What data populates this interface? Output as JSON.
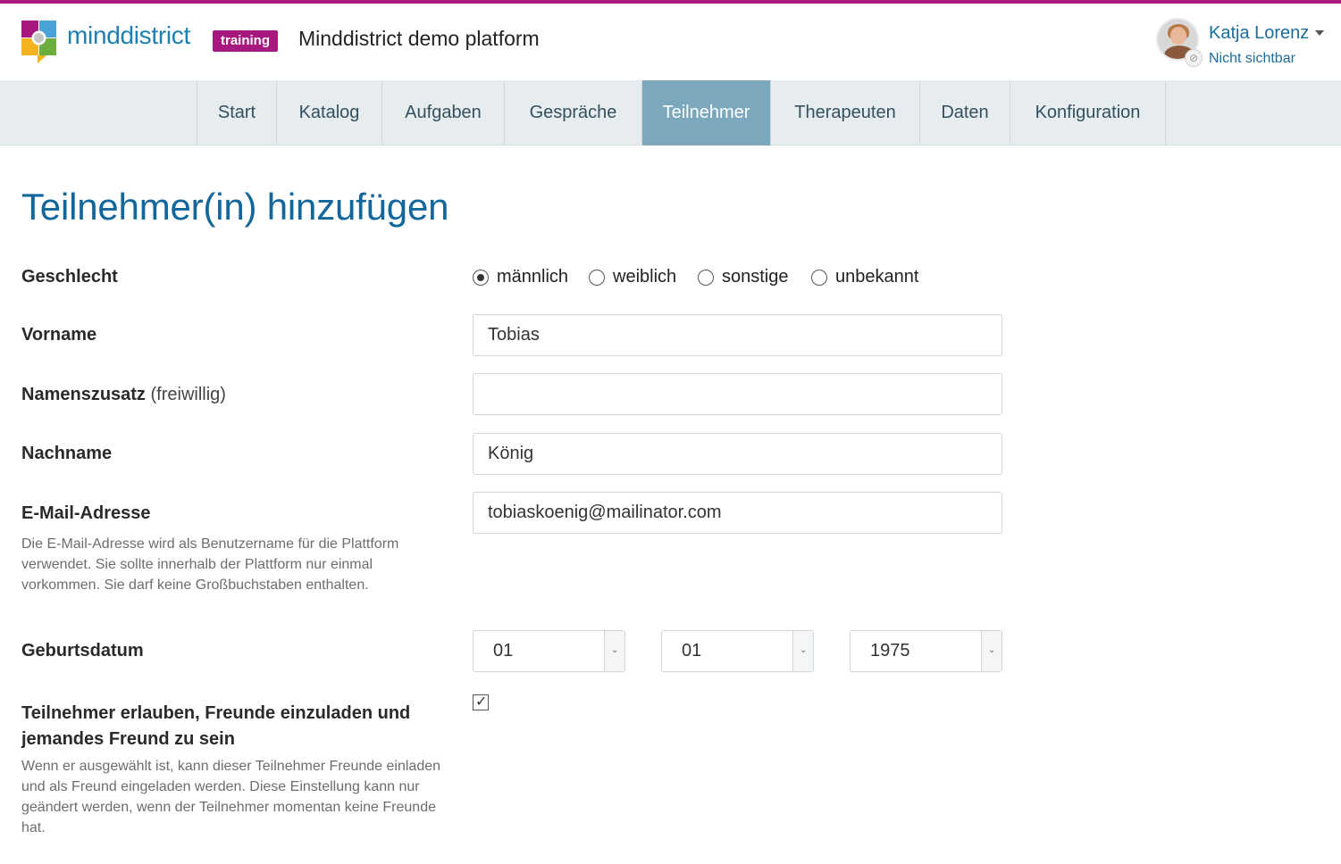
{
  "header": {
    "logo_text": "minddistrict",
    "badge": "training",
    "platform_title": "Minddistrict demo platform",
    "user": {
      "name": "Katja Lorenz",
      "status": "Nicht sichtbar"
    }
  },
  "nav": {
    "items": [
      {
        "label": "Start"
      },
      {
        "label": "Katalog"
      },
      {
        "label": "Aufgaben"
      },
      {
        "label": "Gespräche"
      },
      {
        "label": "Teilnehmer"
      },
      {
        "label": "Therapeuten"
      },
      {
        "label": "Daten"
      },
      {
        "label": "Konfiguration"
      }
    ],
    "active": "Teilnehmer"
  },
  "page": {
    "title": "Teilnehmer(in) hinzufügen"
  },
  "form": {
    "gender": {
      "label": "Geschlecht",
      "options": [
        "männlich",
        "weiblich",
        "sonstige",
        "unbekannt"
      ],
      "selected": "männlich"
    },
    "firstname": {
      "label": "Vorname",
      "value": "Tobias"
    },
    "suffix": {
      "label": "Namenszusatz",
      "optional": "(freiwillig)",
      "value": ""
    },
    "lastname": {
      "label": "Nachname",
      "value": "König"
    },
    "email": {
      "label": "E-Mail-Adresse",
      "value": "tobiaskoenig@mailinator.com",
      "help": "Die E-Mail-Adresse wird als Benutzername für die Plattform verwendet. Sie sollte innerhalb der Plattform nur einmal vorkommen. Sie darf keine Großbuchstaben enthalten."
    },
    "birthdate": {
      "label": "Geburtsdatum",
      "day": "01",
      "month": "01",
      "year": "1975"
    },
    "friends": {
      "label": "Teilnehmer erlauben, Freunde einzuladen und jemandes Freund zu sein",
      "checked": true,
      "help": "Wenn er ausgewählt ist, kann dieser Teilnehmer Freunde einladen und als Freund eingeladen werden. Diese Einstellung kann nur geändert werden, wenn der Teilnehmer momentan keine Freunde hat."
    }
  },
  "colors": {
    "brand_magenta": "#a8197f",
    "brand_blue": "#1b7fb0",
    "nav_active": "#7ba8bd",
    "nav_bg": "#e7ecef",
    "title_blue": "#11669b"
  }
}
